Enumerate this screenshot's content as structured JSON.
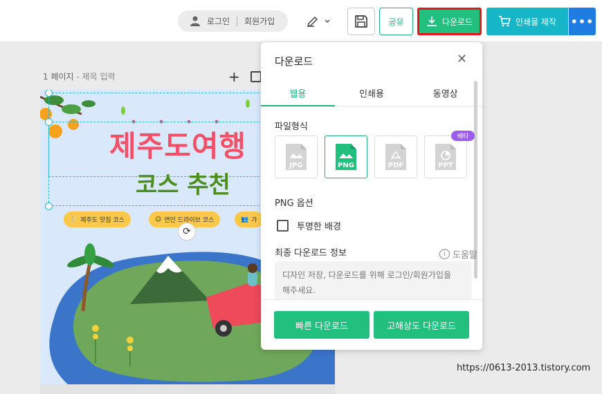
{
  "header": {
    "login": "로그인",
    "signup": "회원가입",
    "share_label": "공유",
    "download_label": "다운로드",
    "print_label": "인쇄물 제작",
    "more_label": "•••"
  },
  "page": {
    "number_label": "1 페이지",
    "title_placeholder": "- 제목 입력",
    "add_icon": "+"
  },
  "canvas": {
    "title_main": "제주도여행",
    "title_sub": "코스 추천",
    "chips": [
      "제주도 맛집 코스",
      "연인 드라이브 코스",
      "가"
    ]
  },
  "download_panel": {
    "title": "다운로드",
    "close": "✕",
    "tabs": [
      {
        "label": "웹용",
        "active": true
      },
      {
        "label": "인쇄용",
        "active": false
      },
      {
        "label": "동영상",
        "active": false
      }
    ],
    "file_format_label": "파일형식",
    "formats": [
      {
        "label": "JPG",
        "active": false
      },
      {
        "label": "PNG",
        "active": true
      },
      {
        "label": "PDF",
        "active": false
      },
      {
        "label": "PPT",
        "active": false
      }
    ],
    "beta_badge": "베타",
    "png_options_label": "PNG 옵션",
    "transparent_bg_label": "투명한 배경",
    "final_info_label": "최종 다운로드 정보",
    "help_label": "도움말",
    "info_text_line1": "디자인 저장, 다운로드를 위해 로그인/회원가입을",
    "info_text_line2": "해주세요.",
    "fast_download": "빠른 다운로드",
    "hq_download": "고해상도 다운로드"
  },
  "watermark": "https://0613-2013.tistory.com",
  "colors": {
    "green": "#22c07f",
    "teal": "#17b5c8",
    "blue": "#1f7de2",
    "highlight_red": "#e8141c",
    "beta_purple": "#9c5cf0",
    "title_pink": "#f34f66",
    "title_green": "#4c8f1c"
  }
}
